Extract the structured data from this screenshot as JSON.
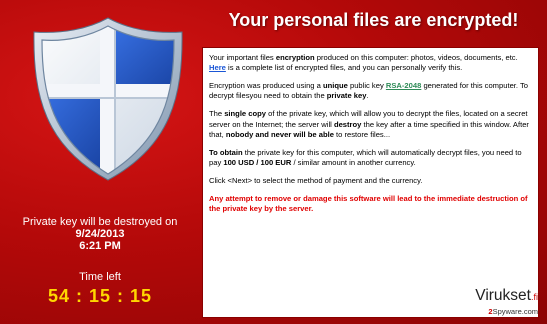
{
  "window": {
    "title": "Your personal files are encrypted!"
  },
  "left": {
    "destroy_label": "Private key will be destroyed on",
    "destroy_date": "9/24/2013",
    "destroy_time": "6:21 PM",
    "time_left_label": "Time left",
    "countdown": "54 : 15 : 15"
  },
  "panel": {
    "p1": {
      "t1": "Your important files ",
      "b1": "encryption",
      "t2": " produced on this computer: photos, videos, documents, etc. ",
      "link": "Here",
      "t3": " is a complete list of encrypted files, and you can personally verify this."
    },
    "p2": {
      "t1": "Encryption was produced using a ",
      "b1": "unique",
      "t2": " public key ",
      "key": "RSA-2048",
      "t3": " generated for this computer. To decrypt filesyou need to obtain the ",
      "b2": "private key",
      "t4": "."
    },
    "p3": {
      "t1": "The ",
      "b1": "single copy",
      "t2": " of the private key, which will allow you to decrypt the files, located on a secret server on the Internet; the server will ",
      "b2": "destroy",
      "t3": " the key after a time specified in this window. After that, ",
      "b3": "nobody and never will be able",
      "t4": " to restore files..."
    },
    "p4": {
      "b1": "To obtain",
      "t1": " the private key for this computer, which will automatically decrypt files, you need to pay ",
      "b2": "100 USD / 100 EUR",
      "t2": " /  similar amount in another currency."
    },
    "p5": "Click <Next> to select the method of payment and the currency.",
    "p6": "Any attempt to remove or damage this software will lead to the immediate destruction of the private key by the server."
  },
  "watermark": {
    "main": "Virukset",
    "suffix": ".fi",
    "sub_num": "2",
    "sub_text": "Spyware.com"
  },
  "colors": {
    "background": "#b40909",
    "countdown": "#ffd700",
    "warning_text": "#e00000",
    "link": "#1a56d6",
    "key_link": "#2e8b57",
    "shield_blue": "#1f55c9",
    "shield_border": "#9fb6cf"
  },
  "icons": {
    "shield": "shield-cross-icon"
  }
}
